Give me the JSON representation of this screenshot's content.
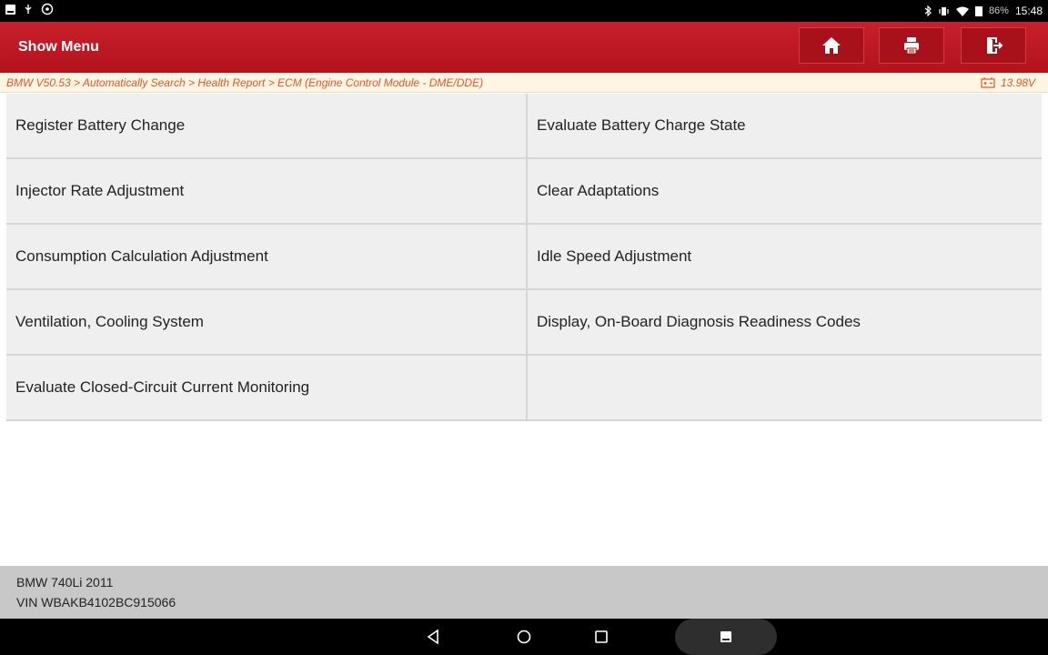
{
  "status_bar": {
    "battery": "86%",
    "time": "15:48"
  },
  "header": {
    "title": "Show Menu",
    "icons": [
      "home-icon",
      "print-icon",
      "exit-icon"
    ]
  },
  "breadcrumb": {
    "path": "BMW V50.53 > Automatically Search > Health Report > ECM (Engine Control Module - DME/DDE)",
    "voltage": "13.98V"
  },
  "menu": {
    "items": [
      "Register Battery Change",
      "Evaluate Battery Charge State",
      "Injector Rate Adjustment",
      "Clear Adaptations",
      "Consumption Calculation Adjustment",
      "Idle Speed Adjustment",
      "Ventilation, Cooling System",
      "Display, On-Board Diagnosis Readiness Codes",
      "Evaluate Closed-Circuit Current Monitoring"
    ]
  },
  "vehicle": {
    "model": "BMW 740Li 2011",
    "vin": "VIN WBAKB4102BC915066"
  },
  "colors": {
    "header_red": "#c8202c",
    "breadcrumb_text": "#e8542e",
    "breadcrumb_bg": "#fdf6e2"
  }
}
